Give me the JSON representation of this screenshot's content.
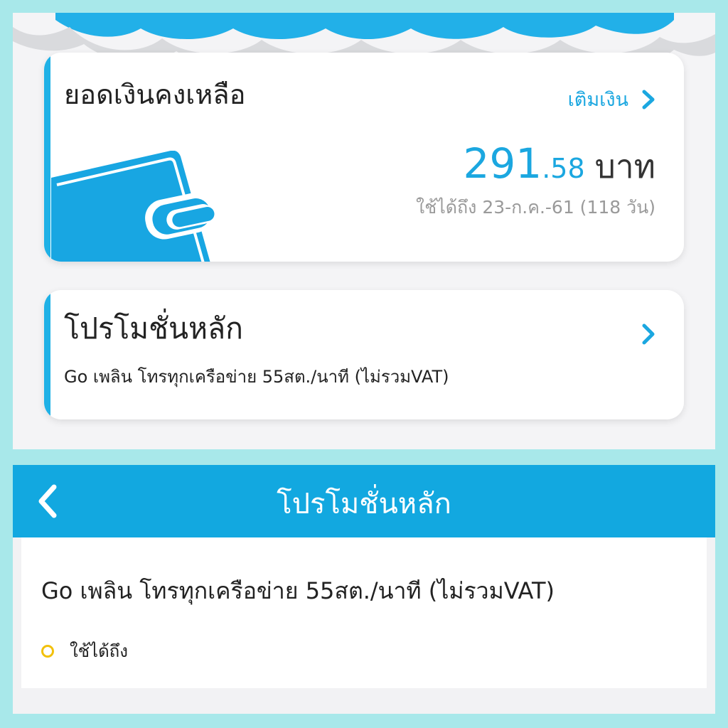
{
  "balance_card": {
    "title": "ยอดเงินคงเหลือ",
    "topup_label": "เติมเงิน",
    "amount_int": "291",
    "amount_dec": ".58",
    "currency": "บาท",
    "valid_until": "ใช้ได้ถึง 23-ก.ค.-61 (118 วัน)"
  },
  "promo_card": {
    "title": "โปรโมชั่นหลัก",
    "description": "Go เพลิน โทรทุกเครือข่าย 55สต./นาที (ไม่รวมVAT)"
  },
  "detail_screen": {
    "nav_title": "โปรโมชั่นหลัก",
    "description": "Go เพลิน โทรทุกเครือข่าย 55สต./นาที (ไม่รวมVAT)",
    "valid_label": "ใช้ได้ถึง"
  },
  "icons": {
    "wallet": "wallet-icon",
    "chevron": "chevron-right-icon",
    "back": "chevron-left-icon",
    "bullet": "circle-bullet-icon"
  },
  "colors": {
    "accent": "#1ba7e0",
    "nav_bar": "#12a8e0",
    "frame": "#a8e8ea",
    "bullet": "#f2c10c"
  }
}
